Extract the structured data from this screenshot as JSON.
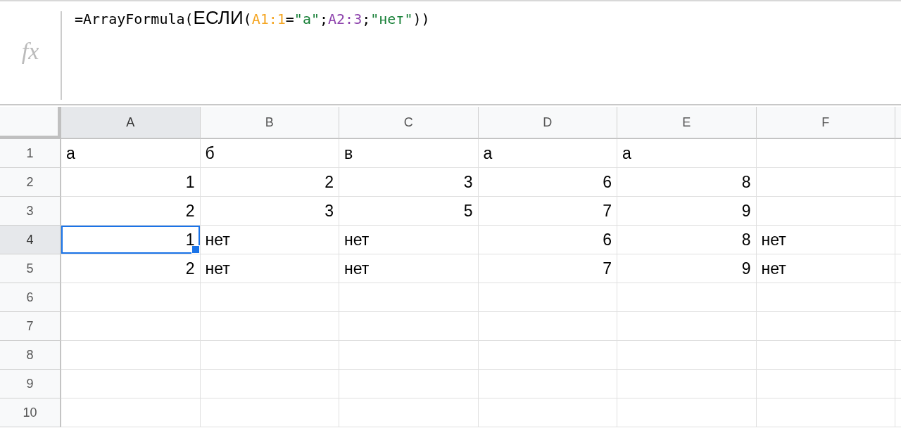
{
  "formula_bar": {
    "fx_label": "fx",
    "tokens": [
      {
        "text": "=ArrayFormula(",
        "color": "#000000",
        "kind": "mono"
      },
      {
        "text": "ЕСЛИ",
        "color": "#000000",
        "kind": "sans"
      },
      {
        "text": "(",
        "color": "#000000",
        "kind": "mono"
      },
      {
        "text": "A1:1",
        "color": "#f5a623",
        "kind": "mono"
      },
      {
        "text": "=",
        "color": "#000000",
        "kind": "mono"
      },
      {
        "text": "\"а\"",
        "color": "#188038",
        "kind": "mono"
      },
      {
        "text": ";",
        "color": "#000000",
        "kind": "mono"
      },
      {
        "text": "A2:3",
        "color": "#8e44ad",
        "kind": "mono"
      },
      {
        "text": ";",
        "color": "#000000",
        "kind": "mono"
      },
      {
        "text": "\"нет\"",
        "color": "#188038",
        "kind": "mono"
      },
      {
        "text": "))",
        "color": "#000000",
        "kind": "mono"
      }
    ]
  },
  "columns": [
    {
      "label": "A",
      "selected": true
    },
    {
      "label": "B",
      "selected": false
    },
    {
      "label": "C",
      "selected": false
    },
    {
      "label": "D",
      "selected": false
    },
    {
      "label": "E",
      "selected": false
    },
    {
      "label": "F",
      "selected": false
    }
  ],
  "rows": [
    {
      "label": "1",
      "selected": false,
      "cells": [
        {
          "text": "а",
          "kind": "text",
          "selected": false
        },
        {
          "text": "б",
          "kind": "text",
          "selected": false
        },
        {
          "text": "в",
          "kind": "text",
          "selected": false
        },
        {
          "text": "а",
          "kind": "text",
          "selected": false
        },
        {
          "text": "а",
          "kind": "text",
          "selected": false
        }
      ]
    },
    {
      "label": "2",
      "selected": false,
      "cells": [
        {
          "text": "1",
          "kind": "number",
          "selected": false
        },
        {
          "text": "2",
          "kind": "number",
          "selected": false
        },
        {
          "text": "3",
          "kind": "number",
          "selected": false
        },
        {
          "text": "6",
          "kind": "number",
          "selected": false
        },
        {
          "text": "8",
          "kind": "number",
          "selected": false
        }
      ]
    },
    {
      "label": "3",
      "selected": false,
      "cells": [
        {
          "text": "2",
          "kind": "number",
          "selected": false
        },
        {
          "text": "3",
          "kind": "number",
          "selected": false
        },
        {
          "text": "5",
          "kind": "number",
          "selected": false
        },
        {
          "text": "7",
          "kind": "number",
          "selected": false
        },
        {
          "text": "9",
          "kind": "number",
          "selected": false
        }
      ]
    },
    {
      "label": "4",
      "selected": true,
      "cells": [
        {
          "text": "1",
          "kind": "number",
          "selected": true
        },
        {
          "text": "нет",
          "kind": "text",
          "selected": false
        },
        {
          "text": "нет",
          "kind": "text",
          "selected": false
        },
        {
          "text": "6",
          "kind": "number",
          "selected": false
        },
        {
          "text": "8",
          "kind": "number",
          "selected": false
        },
        {
          "text": "нет",
          "kind": "text",
          "selected": false
        }
      ]
    },
    {
      "label": "5",
      "selected": false,
      "cells": [
        {
          "text": "2",
          "kind": "number",
          "selected": false
        },
        {
          "text": "нет",
          "kind": "text",
          "selected": false
        },
        {
          "text": "нет",
          "kind": "text",
          "selected": false
        },
        {
          "text": "7",
          "kind": "number",
          "selected": false
        },
        {
          "text": "9",
          "kind": "number",
          "selected": false
        },
        {
          "text": "нет",
          "kind": "text",
          "selected": false
        }
      ]
    },
    {
      "label": "6",
      "selected": false,
      "cells": []
    },
    {
      "label": "7",
      "selected": false,
      "cells": []
    },
    {
      "label": "8",
      "selected": false,
      "cells": []
    },
    {
      "label": "9",
      "selected": false,
      "cells": []
    },
    {
      "label": "10",
      "selected": false,
      "cells": []
    }
  ]
}
